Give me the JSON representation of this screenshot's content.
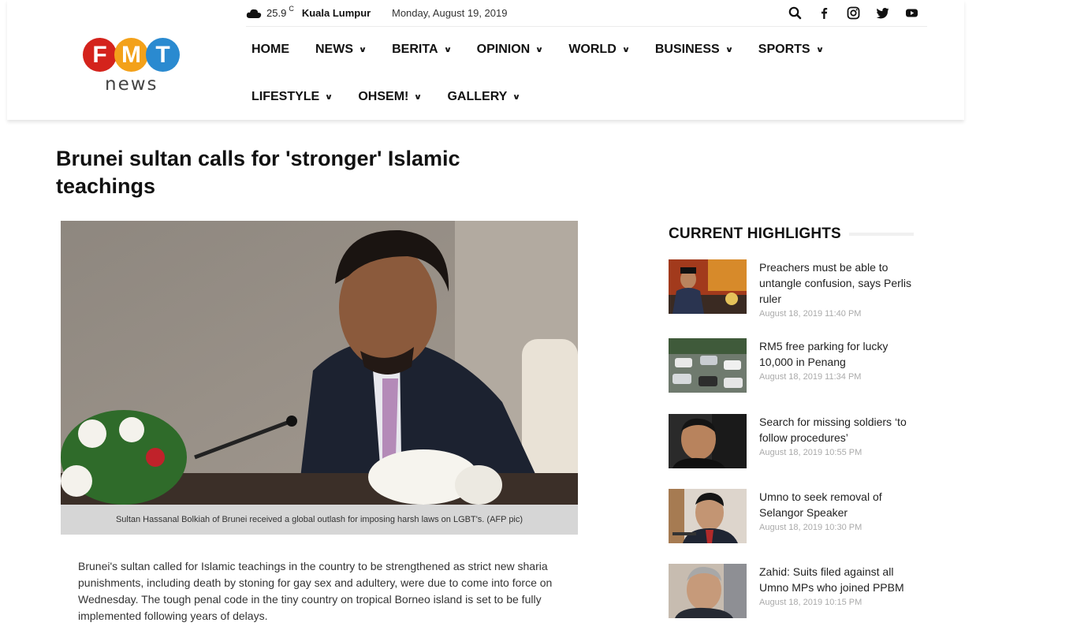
{
  "topbar": {
    "temperature": "25.9",
    "degree_unit": "C",
    "city": "Kuala Lumpur",
    "date": "Monday, August 19, 2019",
    "icons": [
      "cloud-icon",
      "search-icon",
      "facebook-icon",
      "instagram-icon",
      "twitter-icon",
      "youtube-icon"
    ]
  },
  "logo": {
    "letters": [
      "F",
      "M",
      "T"
    ],
    "word": "news",
    "colors": [
      "#d4231c",
      "#f3a11a",
      "#2a8ad0"
    ]
  },
  "nav": {
    "row1": [
      {
        "label": "HOME",
        "dropdown": false
      },
      {
        "label": "NEWS",
        "dropdown": true
      },
      {
        "label": "BERITA",
        "dropdown": true
      },
      {
        "label": "OPINION",
        "dropdown": true
      },
      {
        "label": "WORLD",
        "dropdown": true
      },
      {
        "label": "BUSINESS",
        "dropdown": true
      },
      {
        "label": "SPORTS",
        "dropdown": true
      }
    ],
    "row2": [
      {
        "label": "LIFESTYLE",
        "dropdown": true
      },
      {
        "label": "OHSEM!",
        "dropdown": true
      },
      {
        "label": "GALLERY",
        "dropdown": true
      }
    ]
  },
  "article": {
    "title": "Brunei sultan calls for 'stronger' Islamic teachings",
    "caption": "Sultan Hassanal Bolkiah of Brunei received a global outlash for imposing harsh laws on LGBT's. (AFP pic)",
    "body": "Brunei's sultan called for Islamic teachings in the country to be strengthened as strict new sharia punishments, including death by stoning for gay sex and adultery, were due to come into force on Wednesday. The tough penal code in the tiny country on tropical Borneo island is set to be fully implemented following years of delays."
  },
  "sidebar": {
    "title": "CURRENT HIGHLIGHTS",
    "items": [
      {
        "title": "Preachers must be able to untangle confusion, says Perlis ruler",
        "date": "August 18, 2019 11:40 PM"
      },
      {
        "title": "RM5 free parking for lucky 10,000 in Penang",
        "date": "August 18, 2019 11:34 PM"
      },
      {
        "title": "Search for missing soldiers ‘to follow procedures’",
        "date": "August 18, 2019 10:55 PM"
      },
      {
        "title": "Umno to seek removal of Selangor Speaker",
        "date": "August 18, 2019 10:30 PM"
      },
      {
        "title": "Zahid: Suits filed against all Umno MPs who joined PPBM",
        "date": "August 18, 2019 10:15 PM"
      }
    ]
  }
}
